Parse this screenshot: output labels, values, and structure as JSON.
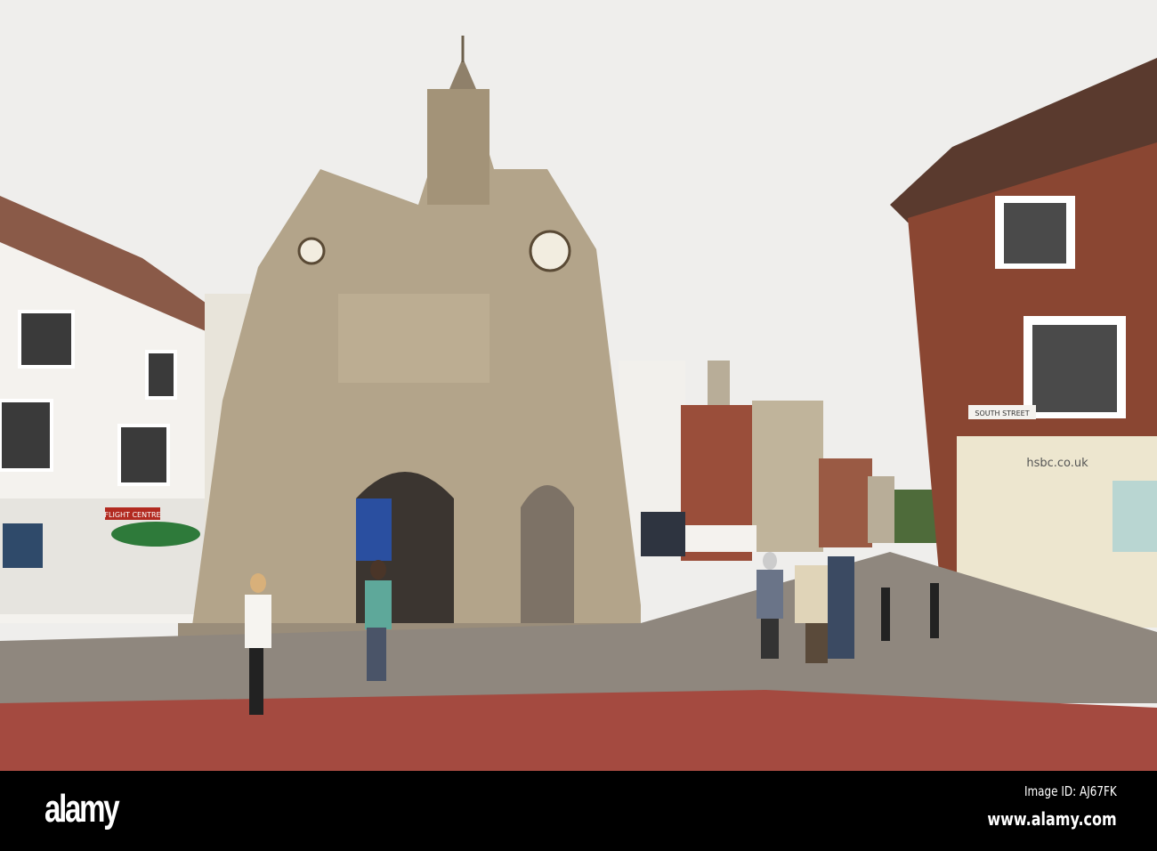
{
  "photo": {
    "signs": {
      "shop_left": "FLIGHT CENTRE",
      "street": "SOUTH STREET",
      "bank": "hsbc.co.uk"
    }
  },
  "footer": {
    "logo": "alamy",
    "image_id": "Image ID: AJ67FK",
    "url": "www.alamy.com"
  }
}
